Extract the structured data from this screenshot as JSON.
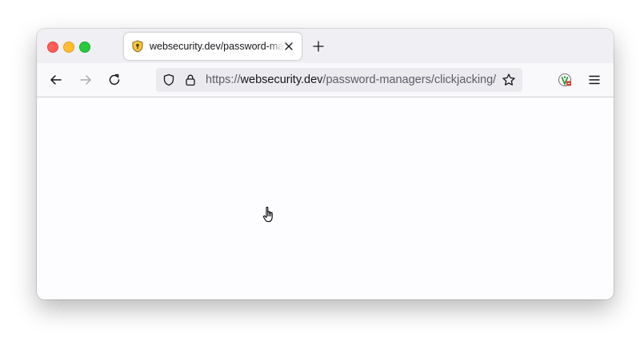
{
  "tab": {
    "title": "websecurity.dev/password-managers/clickjacking/",
    "favicon": "shield-key-icon"
  },
  "urlbar": {
    "scheme": "https://",
    "host": "websecurity.dev",
    "path": "/password-managers/clickjacking/"
  },
  "icons": {
    "tab_close": "close-icon",
    "new_tab": "plus-icon",
    "back": "arrow-left-icon",
    "forward": "arrow-right-icon",
    "reload": "reload-icon",
    "tracking_protection": "shield-icon",
    "lock": "lock-icon",
    "bookmark": "star-icon",
    "extension": "extension-icon",
    "menu": "hamburger-menu-icon",
    "cursor": "hand-pointer-icon"
  },
  "colors": {
    "close": "#ff5f57",
    "minimize": "#febc2e",
    "maximize": "#28c840",
    "tab_strip": "#f0f0f4",
    "toolbar": "#f9f9fb",
    "urlbar": "#ebebef"
  }
}
